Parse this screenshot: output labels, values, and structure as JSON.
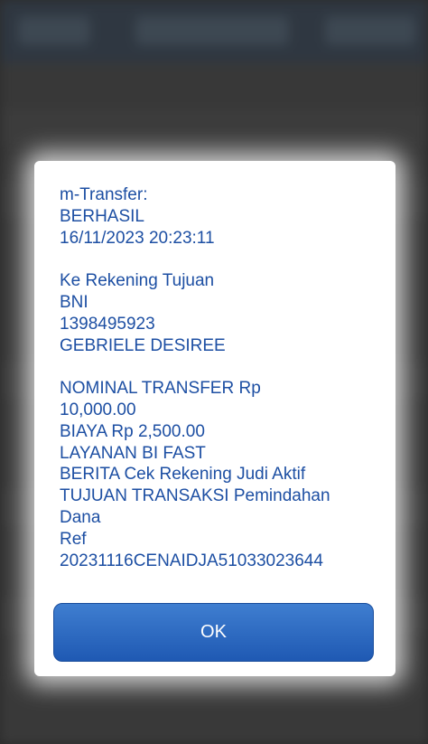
{
  "dialog": {
    "title": "m-Transfer:",
    "status": "BERHASIL",
    "datetime": "16/11/2023 20:23:11",
    "destination_label": "Ke Rekening Tujuan",
    "bank": "BNI",
    "account_number": "1398495923",
    "account_name": "GEBRIELE DESIREE",
    "nominal_label": "NOMINAL TRANSFER Rp",
    "nominal_value": "10,000.00",
    "fee": "BIAYA Rp 2,500.00",
    "service": "LAYANAN BI FAST",
    "news": "BERITA Cek Rekening Judi Aktif",
    "purpose_line1": "TUJUAN TRANSAKSI Pemindahan",
    "purpose_line2": "Dana",
    "ref_label": "Ref",
    "ref_value": "20231116CENAIDJA51033023644",
    "ok_label": "OK"
  },
  "colors": {
    "text": "#1d4fa3",
    "button": "#2a66bf",
    "button_text": "#ffffff"
  }
}
